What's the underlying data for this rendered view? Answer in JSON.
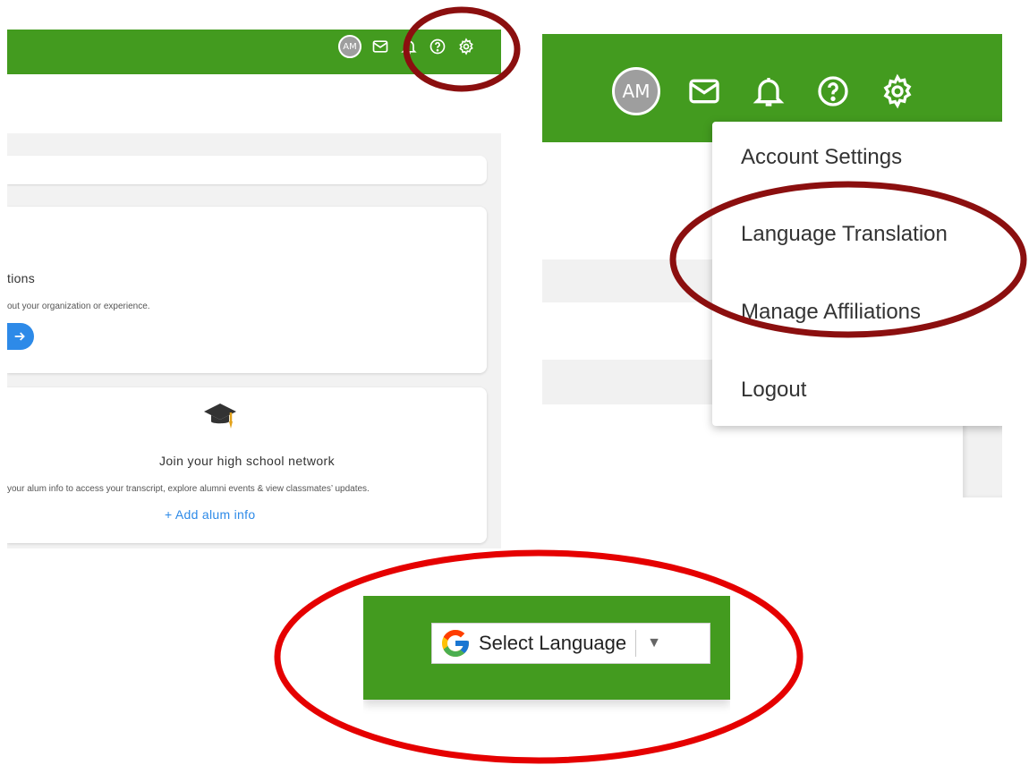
{
  "panel_left": {
    "avatar_initials": "AM",
    "icons": [
      "avatar",
      "mail-icon",
      "bell-icon",
      "help-icon",
      "settings-icon"
    ],
    "card_affiliations": {
      "title_fragment": "tions",
      "description_fragment": "out your organization or experience.",
      "arrow_icon": "arrow-right-icon"
    },
    "card_alumni": {
      "icon": "graduation-cap-icon",
      "title": "Join your high school network",
      "description_fragment": "your alum info to access your transcript, explore alumni events & view classmates’ updates.",
      "link": "+ Add alum info"
    }
  },
  "panel_menu": {
    "avatar_initials": "AM",
    "menu_items": [
      "Account Settings",
      "Language Translation",
      "Manage Affiliations",
      "Logout"
    ]
  },
  "panel_translate": {
    "select_label": "Select Language",
    "caret": "▼"
  },
  "colors": {
    "header_green": "#439b1f",
    "link_blue": "#2d8ae8",
    "annotation_dark_red": "#8b0f0f",
    "annotation_red": "#e50000"
  }
}
